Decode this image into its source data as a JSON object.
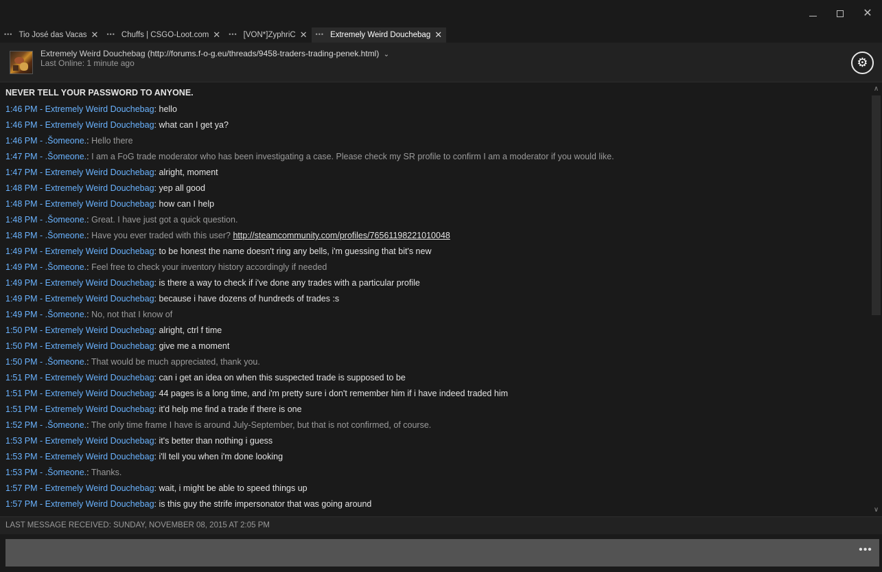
{
  "window": {
    "minimize_label": "–",
    "maximize_label": "□",
    "close_label": "✕"
  },
  "tabs": [
    {
      "label": "Tio José das Vacas",
      "active": false
    },
    {
      "label": "Chuffs | CSGO-Loot.com",
      "active": false
    },
    {
      "label": "[VON*]ZyphriC",
      "active": false
    },
    {
      "label": "Extremely Weird Douchebag",
      "active": true
    }
  ],
  "tab_close_glyph": "✕",
  "tab_menu_glyph": "•••",
  "header": {
    "friend_name": "Extremely Weird Douchebag",
    "friend_url": "(http://forums.f-o-g.eu/threads/9458-traders-trading-penek.html)",
    "last_online": "Last Online: 1 minute ago",
    "settings_icon": "gear-icon"
  },
  "log": {
    "warning": "NEVER TELL YOUR PASSWORD TO ANYONE.",
    "messages": [
      {
        "time": "1:46 PM",
        "sender": "Extremely Weird Douchebag",
        "text": "hello",
        "self": false
      },
      {
        "time": "1:46 PM",
        "sender": "Extremely Weird Douchebag",
        "text": "what can I get ya?",
        "self": false
      },
      {
        "time": "1:46 PM",
        "sender": ".Šomeone.",
        "text": "Hello there",
        "self": true
      },
      {
        "time": "1:47 PM",
        "sender": ".Šomeone.",
        "text": "I am a FoG trade moderator who has been investigating a case. Please check my SR profile to confirm I am a moderator if you would like.",
        "self": true
      },
      {
        "time": "1:47 PM",
        "sender": "Extremely Weird Douchebag",
        "text": "alright, moment",
        "self": false
      },
      {
        "time": "1:48 PM",
        "sender": "Extremely Weird Douchebag",
        "text": "yep all good",
        "self": false
      },
      {
        "time": "1:48 PM",
        "sender": "Extremely Weird Douchebag",
        "text": "how can I help",
        "self": false
      },
      {
        "time": "1:48 PM",
        "sender": ".Šomeone.",
        "text": "Great. I have just got a quick question.",
        "self": true
      },
      {
        "time": "1:48 PM",
        "sender": ".Šomeone.",
        "text": "Have you ever traded with this user?",
        "link": "http://steamcommunity.com/profiles/76561198221010048",
        "self": true
      },
      {
        "time": "1:49 PM",
        "sender": "Extremely Weird Douchebag",
        "text": "to be honest the name doesn't ring any bells, i'm guessing that bit's new",
        "self": false
      },
      {
        "time": "1:49 PM",
        "sender": ".Šomeone.",
        "text": "Feel free to check your inventory history accordingly if needed",
        "self": true
      },
      {
        "time": "1:49 PM",
        "sender": "Extremely Weird Douchebag",
        "text": "is there a way to check if i've done any trades with a particular profile",
        "self": false
      },
      {
        "time": "1:49 PM",
        "sender": "Extremely Weird Douchebag",
        "text": "because i have dozens of hundreds of trades :s",
        "self": false
      },
      {
        "time": "1:49 PM",
        "sender": ".Šomeone.",
        "text": "No, not that I know of",
        "self": true
      },
      {
        "time": "1:50 PM",
        "sender": "Extremely Weird Douchebag",
        "text": "alright, ctrl f time",
        "self": false
      },
      {
        "time": "1:50 PM",
        "sender": "Extremely Weird Douchebag",
        "text": "give me a moment",
        "self": false
      },
      {
        "time": "1:50 PM",
        "sender": ".Šomeone.",
        "text": "That would be much appreciated, thank you.",
        "self": true
      },
      {
        "time": "1:51 PM",
        "sender": "Extremely Weird Douchebag",
        "text": "can i get an idea on when this suspected trade is supposed to be",
        "self": false
      },
      {
        "time": "1:51 PM",
        "sender": "Extremely Weird Douchebag",
        "text": "44 pages is a long time, and i'm pretty sure i don't remember him if i have indeed traded him",
        "self": false
      },
      {
        "time": "1:51 PM",
        "sender": "Extremely Weird Douchebag",
        "text": "it'd help me find a trade if there is one",
        "self": false
      },
      {
        "time": "1:52 PM",
        "sender": ".Šomeone.",
        "text": "The only time frame I have is around July-September, but that is not confirmed, of course.",
        "self": true
      },
      {
        "time": "1:53 PM",
        "sender": "Extremely Weird Douchebag",
        "text": "it's better than nothing i guess",
        "self": false
      },
      {
        "time": "1:53 PM",
        "sender": "Extremely Weird Douchebag",
        "text": "i'll tell you when i'm done looking",
        "self": false
      },
      {
        "time": "1:53 PM",
        "sender": ".Šomeone.",
        "text": "Thanks.",
        "self": true
      },
      {
        "time": "1:57 PM",
        "sender": "Extremely Weird Douchebag",
        "text": "wait, i might be able to speed things up",
        "self": false
      },
      {
        "time": "1:57 PM",
        "sender": "Extremely Weird Douchebag",
        "text": "is this guy the strife impersonator that was going around",
        "self": false
      }
    ]
  },
  "status": {
    "last_message": "LAST MESSAGE RECEIVED: SUNDAY, NOVEMBER 08, 2015 AT 2:05 PM"
  },
  "composer": {
    "input_value": "",
    "more_glyph": "•••"
  },
  "colors": {
    "sender_link": "#6ab3ff",
    "self_text": "#9a9a9a",
    "friend_text": "#e4e4e4",
    "background": "#1a1a1a",
    "composer_bg": "#535353"
  }
}
